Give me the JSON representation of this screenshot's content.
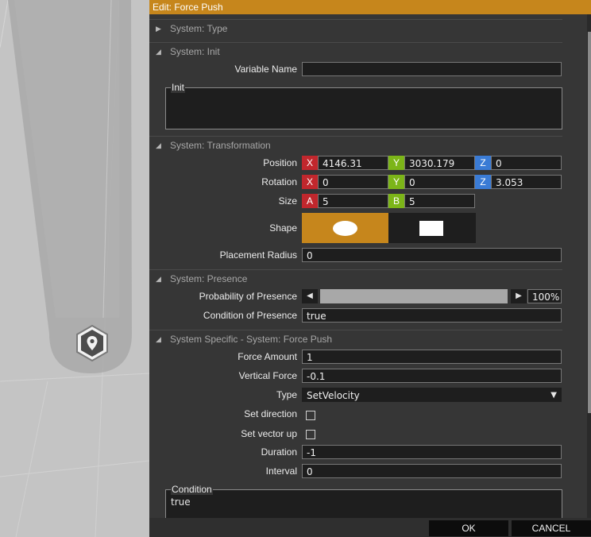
{
  "dialog": {
    "title": "Edit: Force Push",
    "ok_label": "OK",
    "cancel_label": "CANCEL"
  },
  "sections": {
    "type": {
      "title": "System: Type",
      "collapsed": true
    },
    "init": {
      "title": "System: Init",
      "variable_name_label": "Variable Name",
      "variable_name_value": "",
      "init_group_label": "Init",
      "init_value": ""
    },
    "transformation": {
      "title": "System: Transformation",
      "position_label": "Position",
      "position": {
        "x_axis": "X",
        "x": "4146.31",
        "y_axis": "Y",
        "y": "3030.179",
        "z_axis": "Z",
        "z": "0"
      },
      "rotation_label": "Rotation",
      "rotation": {
        "x_axis": "X",
        "x": "0",
        "y_axis": "Y",
        "y": "0",
        "z_axis": "Z",
        "z": "3.053"
      },
      "size_label": "Size",
      "size": {
        "a_axis": "A",
        "a": "5",
        "b_axis": "B",
        "b": "5"
      },
      "shape_label": "Shape",
      "shape_selected": "ellipse",
      "placement_radius_label": "Placement Radius",
      "placement_radius_value": "0"
    },
    "presence": {
      "title": "System: Presence",
      "probability_label": "Probability of Presence",
      "probability_value": "100%",
      "probability_fraction": 1.0,
      "condition_label": "Condition of Presence",
      "condition_value": "true"
    },
    "specific": {
      "title": "System Specific - System: Force Push",
      "force_amount_label": "Force Amount",
      "force_amount_value": "1",
      "vertical_force_label": "Vertical Force",
      "vertical_force_value": "-0.1",
      "type_label": "Type",
      "type_value": "SetVelocity",
      "set_direction_label": "Set direction",
      "set_direction_checked": false,
      "set_vector_up_label": "Set vector up",
      "set_vector_up_checked": false,
      "duration_label": "Duration",
      "duration_value": "-1",
      "interval_label": "Interval",
      "interval_value": "0",
      "condition_group_label": "Condition",
      "condition_value": "true"
    }
  },
  "colors": {
    "title_bar": "#c6861c",
    "axis_x": "#c1272d",
    "axis_y": "#7cb518",
    "axis_z": "#3a7bd5",
    "shape_selected_bg": "#c6861c"
  },
  "icons": {
    "viewport_marker": "map-pin-hexagon-icon",
    "collapsed": "triangle-right-icon",
    "expanded": "triangle-down-icon",
    "dropdown": "triangle-down-icon"
  }
}
